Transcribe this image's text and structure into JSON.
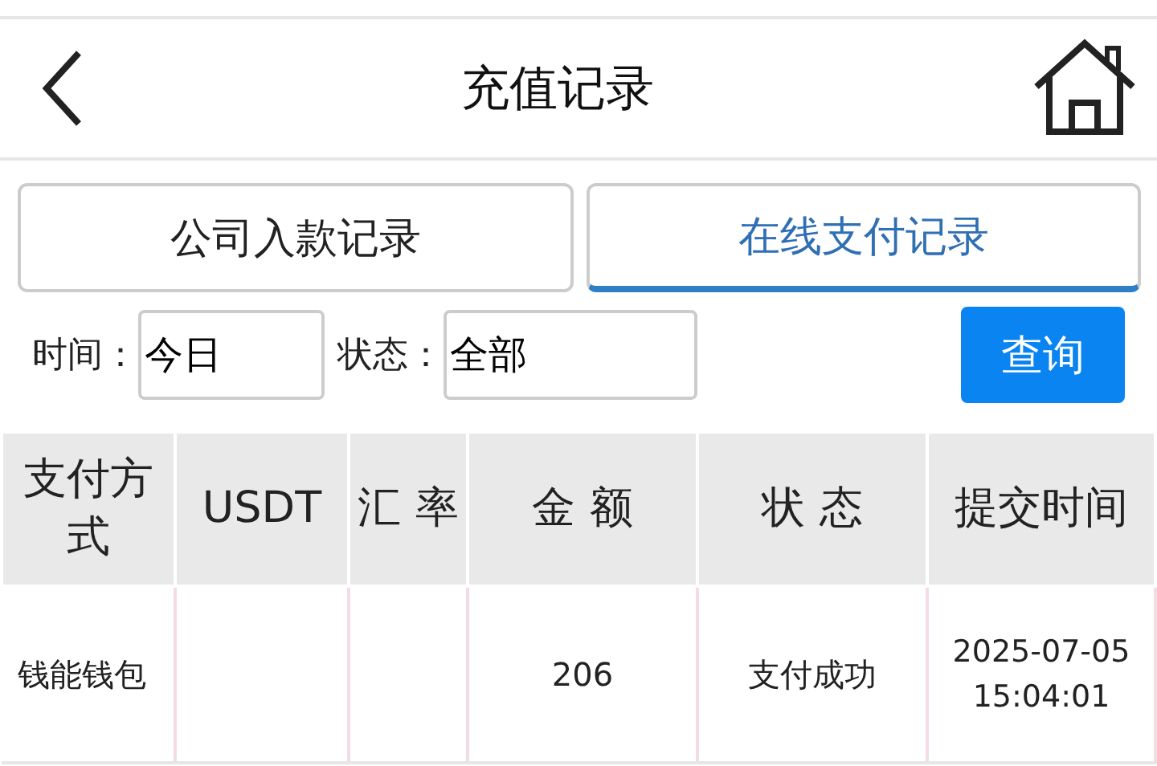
{
  "header": {
    "title": "充值记录"
  },
  "tabs": [
    {
      "label": "公司入款记录",
      "selected": false
    },
    {
      "label": "在线支付记录",
      "selected": true
    }
  ],
  "filters": {
    "time_label": "时间：",
    "time_value": "今日",
    "status_label": "状态：",
    "status_value": "全部",
    "query_button": "查询"
  },
  "table": {
    "columns": [
      "支付方式",
      "USDT",
      "汇 率",
      "金 额",
      "状 态",
      "提交时间"
    ],
    "rows": [
      {
        "payment_method": "钱能钱包",
        "amount": "206",
        "status": "支付成功",
        "submitted_at": "2025-07-05 15:04:01"
      }
    ]
  }
}
